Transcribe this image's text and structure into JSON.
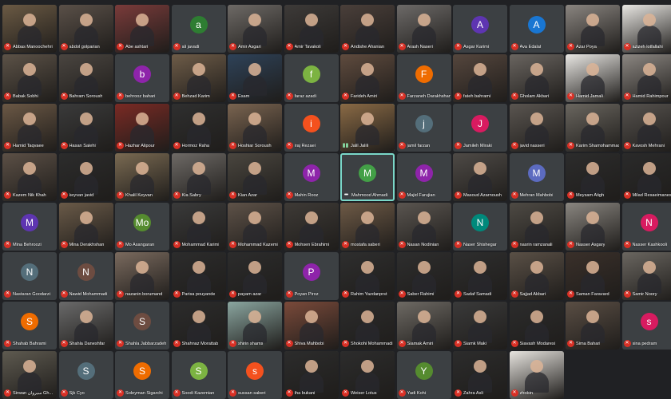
{
  "meeting": {
    "participants": [
      {
        "name": "Abbas Manoochehri",
        "type": "video",
        "bg": "#6b5a44"
      },
      {
        "name": "abdol golparian",
        "type": "video",
        "bg": "#5a5048"
      },
      {
        "name": "Abe ashtari",
        "type": "video",
        "bg": "#7a3b3a"
      },
      {
        "name": "ali javadi",
        "type": "avatar",
        "letter": "a",
        "color": "#2e7d32"
      },
      {
        "name": "Amir Asgari",
        "type": "video",
        "bg": "#6e6a66"
      },
      {
        "name": "Amir Tavakoli",
        "type": "video",
        "bg": "#3d3a38"
      },
      {
        "name": "Andishe Ahanian",
        "type": "video",
        "bg": "#4a3f3a"
      },
      {
        "name": "Arash Naseri",
        "type": "video",
        "bg": "#6d6a68"
      },
      {
        "name": "Asgar Karimi",
        "type": "avatar",
        "letter": "A",
        "color": "#5e35b1"
      },
      {
        "name": "Ava Edalat",
        "type": "avatar",
        "letter": "A",
        "color": "#1976d2"
      },
      {
        "name": "Azar Poya",
        "type": "video",
        "bg": "#8a8580"
      },
      {
        "name": "azizeh lotfallahi",
        "type": "video",
        "bg": "#e8e6e2"
      },
      {
        "name": "Babak Sobhi",
        "type": "video",
        "bg": "#5c5247"
      },
      {
        "name": "Bahram Soroush",
        "type": "video",
        "bg": "#4a4540"
      },
      {
        "name": "behrooz bahari",
        "type": "avatar",
        "letter": "b",
        "color": "#8e24aa"
      },
      {
        "name": "Behzad Karim",
        "type": "video",
        "bg": "#6e5c48"
      },
      {
        "name": "Esam",
        "type": "video",
        "bg": "#2e4258"
      },
      {
        "name": "faraz azadi",
        "type": "avatar",
        "letter": "f",
        "color": "#7cb342"
      },
      {
        "name": "Farideh Amiri",
        "type": "video",
        "bg": "#5f4b3e"
      },
      {
        "name": "Farzaneh Darakhshan",
        "type": "avatar",
        "letter": "F",
        "color": "#ef6c00"
      },
      {
        "name": "fateh bahrami",
        "type": "video",
        "bg": "#55463d"
      },
      {
        "name": "Gholam Akbari",
        "type": "video",
        "bg": "#6a6560"
      },
      {
        "name": "Hamid Jamali",
        "type": "video",
        "bg": "#e9e7e3"
      },
      {
        "name": "Hamid Rahimpour",
        "type": "video",
        "bg": "#8c8782"
      },
      {
        "name": "Hamid Taqvaee",
        "type": "video",
        "bg": "#6b5845"
      },
      {
        "name": "Hasan Salehi",
        "type": "video",
        "bg": "#3a3a3a"
      },
      {
        "name": "Hazhar Alipour",
        "type": "video",
        "bg": "#7a2a24"
      },
      {
        "name": "Hormoz Raha",
        "type": "video",
        "bg": "#2f2f2f"
      },
      {
        "name": "Hoshiar Soroush",
        "type": "video",
        "bg": "#7a6450"
      },
      {
        "name": "iraj Rezaei",
        "type": "avatar",
        "letter": "i",
        "color": "#f4511e"
      },
      {
        "name": "Jalil Jalili",
        "type": "video",
        "bg": "#8a6a45",
        "active": true
      },
      {
        "name": "jamil farzan",
        "type": "avatar",
        "letter": "j",
        "color": "#546e7a"
      },
      {
        "name": "Jamileh Miraki",
        "type": "avatar",
        "letter": "J",
        "color": "#d81b60"
      },
      {
        "name": "javid nasseri",
        "type": "video",
        "bg": "#5a5550"
      },
      {
        "name": "Karim Shamohammadi",
        "type": "video",
        "bg": "#6a665f"
      },
      {
        "name": "Kavosh Mehrani",
        "type": "video",
        "bg": "#56524e"
      },
      {
        "name": "Kazem Nik Khah",
        "type": "video",
        "bg": "#5c5046"
      },
      {
        "name": "keyvan javid",
        "type": "video",
        "bg": "#2c2c2c"
      },
      {
        "name": "Khalil Keyvan",
        "type": "video",
        "bg": "#7a6a52"
      },
      {
        "name": "Kia Sabry",
        "type": "video",
        "bg": "#6e6a66"
      },
      {
        "name": "Kian Azar",
        "type": "video",
        "bg": "#4a463f"
      },
      {
        "name": "Mahin Rooz",
        "type": "avatar",
        "letter": "M",
        "color": "#8e24aa"
      },
      {
        "name": "Mahmood Ahmadi",
        "type": "avatar",
        "letter": "M",
        "color": "#43a047",
        "active": true,
        "more": true
      },
      {
        "name": "Majid Farujian",
        "type": "avatar",
        "letter": "M",
        "color": "#8e24aa"
      },
      {
        "name": "Masoud Azarnoush",
        "type": "video",
        "bg": "#4e4a46"
      },
      {
        "name": "Mehran Mahbobi",
        "type": "avatar",
        "letter": "M",
        "color": "#5c6bc0"
      },
      {
        "name": "Meysam Atigh",
        "type": "video",
        "bg": "#2c2c2c"
      },
      {
        "name": "Milad Resaeimanesh",
        "type": "video",
        "bg": "#2a2a2a"
      },
      {
        "name": "Mina Behroozi",
        "type": "avatar",
        "letter": "M",
        "color": "#5e35b1"
      },
      {
        "name": "Mina Derakhshan",
        "type": "video",
        "bg": "#6a5a48"
      },
      {
        "name": "Mo Asangaran",
        "type": "avatar",
        "letter": "Mo",
        "color": "#558b2f"
      },
      {
        "name": "Mohammad Karimi",
        "type": "video",
        "bg": "#3a3a3a"
      },
      {
        "name": "Mohammad Kazemi",
        "type": "video",
        "bg": "#5e5248"
      },
      {
        "name": "Mohsen Ebrahimi",
        "type": "video",
        "bg": "#3e3a36"
      },
      {
        "name": "mostafa saberi",
        "type": "video",
        "bg": "#6e5a46"
      },
      {
        "name": "Nasan Nodinian",
        "type": "video",
        "bg": "#5a5550"
      },
      {
        "name": "Naser Shishegar",
        "type": "avatar",
        "letter": "N",
        "color": "#00897b"
      },
      {
        "name": "nasrin ramzanali",
        "type": "video",
        "bg": "#4e4a44"
      },
      {
        "name": "Nasser Asgary",
        "type": "video",
        "bg": "#8a8680"
      },
      {
        "name": "Nasser Kashkooli",
        "type": "avatar",
        "letter": "N",
        "color": "#d81b60"
      },
      {
        "name": "Nastaran Goodarzi",
        "type": "avatar",
        "letter": "N",
        "color": "#546e7a"
      },
      {
        "name": "Nawid Mohammadi",
        "type": "avatar",
        "letter": "N",
        "color": "#6d4c41"
      },
      {
        "name": "nazanin borumand",
        "type": "video",
        "bg": "#7a6a5e"
      },
      {
        "name": "Parisa pouyande",
        "type": "video",
        "bg": "#2c2c2c"
      },
      {
        "name": "payam azar",
        "type": "video",
        "bg": "#2c2c2c"
      },
      {
        "name": "Poyan Piroz",
        "type": "avatar",
        "letter": "P",
        "color": "#8e24aa"
      },
      {
        "name": "Rahim Yazdanprst",
        "type": "video",
        "bg": "#2e2e2e"
      },
      {
        "name": "Saber Rahimi",
        "type": "video",
        "bg": "#2e2e2e"
      },
      {
        "name": "Sadaf Samadi",
        "type": "video",
        "bg": "#2e2e2e"
      },
      {
        "name": "Sajjad Akbari",
        "type": "video",
        "bg": "#5a5046"
      },
      {
        "name": "Saman Faravard",
        "type": "video",
        "bg": "#3a302a"
      },
      {
        "name": "Samir Noory",
        "type": "video",
        "bg": "#6a6660"
      },
      {
        "name": "Shahab Bahrami",
        "type": "avatar",
        "letter": "S",
        "color": "#ef6c00"
      },
      {
        "name": "Shahla Daneshfar",
        "type": "video",
        "bg": "#6a6a6a"
      },
      {
        "name": "Shahla Jabbarzadeh",
        "type": "avatar",
        "letter": "S",
        "color": "#6d4c41"
      },
      {
        "name": "Shahnaz Morattab",
        "type": "video",
        "bg": "#2c2c2c"
      },
      {
        "name": "shirin shams",
        "type": "video",
        "bg": "#8ba6a0"
      },
      {
        "name": "Shiva Mahbobi",
        "type": "video",
        "bg": "#7a4a3a"
      },
      {
        "name": "Shokohi Mohammadi",
        "type": "video",
        "bg": "#2c2c2c"
      },
      {
        "name": "Siamak Amiri",
        "type": "video",
        "bg": "#6e6a64"
      },
      {
        "name": "Siamk Maki",
        "type": "video",
        "bg": "#3a3a3a"
      },
      {
        "name": "Siavash Modaresi",
        "type": "video",
        "bg": "#2c2c2c"
      },
      {
        "name": "Sima Bahari",
        "type": "video",
        "bg": "#5a4e44"
      },
      {
        "name": "sina pedram",
        "type": "avatar",
        "letter": "s",
        "color": "#d81b60"
      },
      {
        "name": "Sirwan سیروان Gh...",
        "type": "video",
        "bg": "#5e5a50"
      },
      {
        "name": "Sjk Cyo",
        "type": "avatar",
        "letter": "S",
        "color": "#546e7a"
      },
      {
        "name": "Soleyman Sigarchi",
        "type": "avatar",
        "letter": "S",
        "color": "#ef6c00"
      },
      {
        "name": "Soodi Kazemian",
        "type": "avatar",
        "letter": "S",
        "color": "#7cb342"
      },
      {
        "name": "sussan saberi",
        "type": "avatar",
        "letter": "s",
        "color": "#f4511e"
      },
      {
        "name": "tha bukani",
        "type": "video",
        "bg": "#2c2c2c"
      },
      {
        "name": "Weiser Lotus",
        "type": "video",
        "bg": "#2c2c2c"
      },
      {
        "name": "Yadi Kohi",
        "type": "avatar",
        "letter": "Y",
        "color": "#558b2f"
      },
      {
        "name": "Zahra Asli",
        "type": "video",
        "bg": "#2c2c2c"
      },
      {
        "name": "zhobin",
        "type": "video",
        "bg": "#e7e4df"
      }
    ]
  }
}
